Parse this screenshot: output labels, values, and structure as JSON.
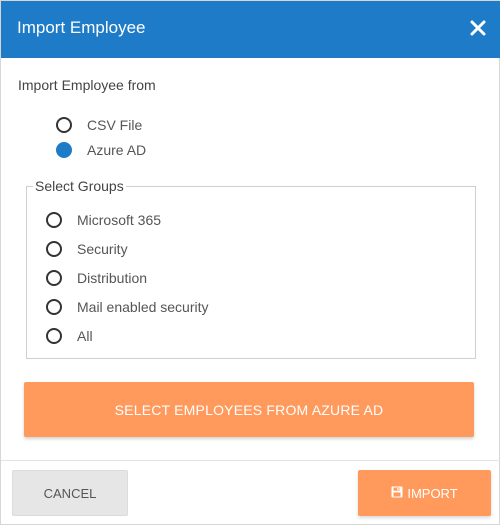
{
  "dialog": {
    "title": "Import Employee",
    "close_icon": "close-icon"
  },
  "import_source": {
    "label": "Import Employee from",
    "options": [
      {
        "label": "CSV File",
        "selected": false
      },
      {
        "label": "Azure AD",
        "selected": true
      }
    ]
  },
  "groups": {
    "legend": "Select Groups",
    "options": [
      {
        "label": "Microsoft 365",
        "selected": false
      },
      {
        "label": "Security",
        "selected": false
      },
      {
        "label": "Distribution",
        "selected": false
      },
      {
        "label": "Mail enabled security",
        "selected": false
      },
      {
        "label": "All",
        "selected": false
      }
    ]
  },
  "actions": {
    "select_employees_label": "SELECT EMPLOYEES FROM AZURE AD",
    "cancel_label": "CANCEL",
    "import_label": "IMPORT",
    "import_icon": "save-icon"
  },
  "colors": {
    "header": "#1e7bc8",
    "accent": "#ff9a5c",
    "radio_selected": "#1e7bc8"
  }
}
